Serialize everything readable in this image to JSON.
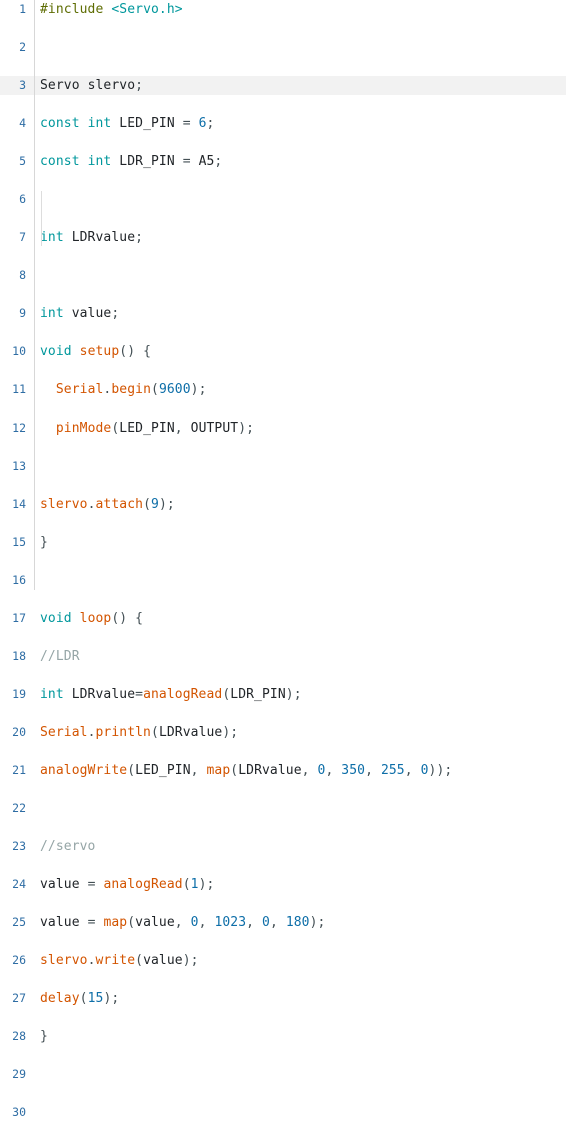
{
  "app": {
    "name": "code-editor",
    "language": "Arduino C++",
    "filename": "sketch"
  },
  "editor": {
    "total_lines": 30,
    "first_visible_line": 1,
    "last_visible_line": 30,
    "highlighted_lines": [
      3
    ],
    "indent_guide_lines": [
      11,
      12,
      13
    ]
  },
  "colors": {
    "background": "#ffffff",
    "highlight_row": "#f2f2f2",
    "gutter_rule": "#d7d7d7",
    "line_number": "#2e6da4",
    "keyword": "#00979c",
    "function": "#d35400",
    "number": "#0d6ea8",
    "comment": "#95a5a6",
    "preprocessor": "#5e6d03",
    "identifier": "#212529",
    "punctuation": "#434f54",
    "indent_guide": "#dddddd"
  },
  "lines": [
    {
      "n": "1",
      "text": "#include <Servo.h>",
      "tokens": [
        {
          "t": "#include",
          "c": "t-pre"
        },
        {
          "t": " ",
          "c": "t-punc"
        },
        {
          "t": "<Servo.h>",
          "c": "t-hdr"
        }
      ]
    },
    {
      "n": "2",
      "text": "",
      "tokens": []
    },
    {
      "n": "3",
      "text": "Servo slervo;",
      "tokens": [
        {
          "t": "Servo",
          "c": "t-id"
        },
        {
          "t": " slervo",
          "c": "t-id"
        },
        {
          "t": ";",
          "c": "t-punc"
        }
      ]
    },
    {
      "n": "4",
      "text": "const int LED_PIN = 6;",
      "tokens": [
        {
          "t": "const",
          "c": "t-kw"
        },
        {
          "t": " ",
          "c": "t-punc"
        },
        {
          "t": "int",
          "c": "t-kw"
        },
        {
          "t": " LED_PIN ",
          "c": "t-id"
        },
        {
          "t": "=",
          "c": "t-op"
        },
        {
          "t": " ",
          "c": "t-punc"
        },
        {
          "t": "6",
          "c": "t-num"
        },
        {
          "t": ";",
          "c": "t-punc"
        }
      ]
    },
    {
      "n": "5",
      "text": "const int LDR_PIN = A5;",
      "tokens": [
        {
          "t": "const",
          "c": "t-kw"
        },
        {
          "t": " ",
          "c": "t-punc"
        },
        {
          "t": "int",
          "c": "t-kw"
        },
        {
          "t": " LDR_PIN ",
          "c": "t-id"
        },
        {
          "t": "=",
          "c": "t-op"
        },
        {
          "t": " A5",
          "c": "t-id"
        },
        {
          "t": ";",
          "c": "t-punc"
        }
      ]
    },
    {
      "n": "6",
      "text": "",
      "tokens": []
    },
    {
      "n": "7",
      "text": "int LDRvalue;",
      "tokens": [
        {
          "t": "int",
          "c": "t-kw"
        },
        {
          "t": " LDRvalue",
          "c": "t-id"
        },
        {
          "t": ";",
          "c": "t-punc"
        }
      ]
    },
    {
      "n": "8",
      "text": "",
      "tokens": []
    },
    {
      "n": "9",
      "text": "int value;",
      "tokens": [
        {
          "t": "int",
          "c": "t-kw"
        },
        {
          "t": " value",
          "c": "t-id"
        },
        {
          "t": ";",
          "c": "t-punc"
        }
      ]
    },
    {
      "n": "10",
      "text": "void setup() {",
      "tokens": [
        {
          "t": "void",
          "c": "t-kw"
        },
        {
          "t": " ",
          "c": "t-punc"
        },
        {
          "t": "setup",
          "c": "t-fn"
        },
        {
          "t": "() {",
          "c": "t-punc"
        }
      ]
    },
    {
      "n": "11",
      "text": "  Serial.begin(9600);",
      "tokens": [
        {
          "t": "  ",
          "c": "t-punc"
        },
        {
          "t": "Serial",
          "c": "t-obj"
        },
        {
          "t": ".",
          "c": "t-punc"
        },
        {
          "t": "begin",
          "c": "t-fn"
        },
        {
          "t": "(",
          "c": "t-punc"
        },
        {
          "t": "9600",
          "c": "t-num"
        },
        {
          "t": ");",
          "c": "t-punc"
        }
      ]
    },
    {
      "n": "12",
      "text": "  pinMode(LED_PIN, OUTPUT);",
      "tokens": [
        {
          "t": "  ",
          "c": "t-punc"
        },
        {
          "t": "pinMode",
          "c": "t-fn"
        },
        {
          "t": "(",
          "c": "t-punc"
        },
        {
          "t": "LED_PIN",
          "c": "t-id"
        },
        {
          "t": ", ",
          "c": "t-punc"
        },
        {
          "t": "OUTPUT",
          "c": "t-id"
        },
        {
          "t": ");",
          "c": "t-punc"
        }
      ]
    },
    {
      "n": "13",
      "text": "",
      "tokens": []
    },
    {
      "n": "14",
      "text": "slervo.attach(9);",
      "tokens": [
        {
          "t": "slervo",
          "c": "t-obj"
        },
        {
          "t": ".",
          "c": "t-punc"
        },
        {
          "t": "attach",
          "c": "t-fn"
        },
        {
          "t": "(",
          "c": "t-punc"
        },
        {
          "t": "9",
          "c": "t-num"
        },
        {
          "t": ");",
          "c": "t-punc"
        }
      ]
    },
    {
      "n": "15",
      "text": "}",
      "tokens": [
        {
          "t": "}",
          "c": "t-punc"
        }
      ]
    },
    {
      "n": "16",
      "text": "",
      "tokens": []
    },
    {
      "n": "17",
      "text": "void loop() {",
      "tokens": [
        {
          "t": "void",
          "c": "t-kw"
        },
        {
          "t": " ",
          "c": "t-punc"
        },
        {
          "t": "loop",
          "c": "t-fn"
        },
        {
          "t": "() {",
          "c": "t-punc"
        }
      ]
    },
    {
      "n": "18",
      "text": "//LDR",
      "tokens": [
        {
          "t": "//LDR",
          "c": "t-cmt"
        }
      ]
    },
    {
      "n": "19",
      "text": "int LDRvalue=analogRead(LDR_PIN);",
      "tokens": [
        {
          "t": "int",
          "c": "t-kw"
        },
        {
          "t": " LDRvalue",
          "c": "t-id"
        },
        {
          "t": "=",
          "c": "t-op"
        },
        {
          "t": "analogRead",
          "c": "t-fn"
        },
        {
          "t": "(",
          "c": "t-punc"
        },
        {
          "t": "LDR_PIN",
          "c": "t-id"
        },
        {
          "t": ");",
          "c": "t-punc"
        }
      ]
    },
    {
      "n": "20",
      "text": "Serial.println(LDRvalue);",
      "tokens": [
        {
          "t": "Serial",
          "c": "t-obj"
        },
        {
          "t": ".",
          "c": "t-punc"
        },
        {
          "t": "println",
          "c": "t-fn"
        },
        {
          "t": "(",
          "c": "t-punc"
        },
        {
          "t": "LDRvalue",
          "c": "t-id"
        },
        {
          "t": ");",
          "c": "t-punc"
        }
      ]
    },
    {
      "n": "21",
      "text": "analogWrite(LED_PIN, map(LDRvalue, 0, 350, 255, 0));",
      "tokens": [
        {
          "t": "analogWrite",
          "c": "t-fn"
        },
        {
          "t": "(",
          "c": "t-punc"
        },
        {
          "t": "LED_PIN",
          "c": "t-id"
        },
        {
          "t": ", ",
          "c": "t-punc"
        },
        {
          "t": "map",
          "c": "t-fn"
        },
        {
          "t": "(",
          "c": "t-punc"
        },
        {
          "t": "LDRvalue",
          "c": "t-id"
        },
        {
          "t": ", ",
          "c": "t-punc"
        },
        {
          "t": "0",
          "c": "t-num"
        },
        {
          "t": ", ",
          "c": "t-punc"
        },
        {
          "t": "350",
          "c": "t-num"
        },
        {
          "t": ", ",
          "c": "t-punc"
        },
        {
          "t": "255",
          "c": "t-num"
        },
        {
          "t": ", ",
          "c": "t-punc"
        },
        {
          "t": "0",
          "c": "t-num"
        },
        {
          "t": "));",
          "c": "t-punc"
        }
      ]
    },
    {
      "n": "22",
      "text": "",
      "tokens": []
    },
    {
      "n": "23",
      "text": "//servo",
      "tokens": [
        {
          "t": "//servo",
          "c": "t-cmt"
        }
      ]
    },
    {
      "n": "24",
      "text": "value = analogRead(1);",
      "tokens": [
        {
          "t": "value ",
          "c": "t-id"
        },
        {
          "t": "=",
          "c": "t-op"
        },
        {
          "t": " ",
          "c": "t-punc"
        },
        {
          "t": "analogRead",
          "c": "t-fn"
        },
        {
          "t": "(",
          "c": "t-punc"
        },
        {
          "t": "1",
          "c": "t-num"
        },
        {
          "t": ");",
          "c": "t-punc"
        }
      ]
    },
    {
      "n": "25",
      "text": "value = map(value, 0, 1023, 0, 180);",
      "tokens": [
        {
          "t": "value ",
          "c": "t-id"
        },
        {
          "t": "=",
          "c": "t-op"
        },
        {
          "t": " ",
          "c": "t-punc"
        },
        {
          "t": "map",
          "c": "t-fn"
        },
        {
          "t": "(",
          "c": "t-punc"
        },
        {
          "t": "value",
          "c": "t-id"
        },
        {
          "t": ", ",
          "c": "t-punc"
        },
        {
          "t": "0",
          "c": "t-num"
        },
        {
          "t": ", ",
          "c": "t-punc"
        },
        {
          "t": "1023",
          "c": "t-num"
        },
        {
          "t": ", ",
          "c": "t-punc"
        },
        {
          "t": "0",
          "c": "t-num"
        },
        {
          "t": ", ",
          "c": "t-punc"
        },
        {
          "t": "180",
          "c": "t-num"
        },
        {
          "t": ");",
          "c": "t-punc"
        }
      ]
    },
    {
      "n": "26",
      "text": "slervo.write(value);",
      "tokens": [
        {
          "t": "slervo",
          "c": "t-obj"
        },
        {
          "t": ".",
          "c": "t-punc"
        },
        {
          "t": "write",
          "c": "t-fn"
        },
        {
          "t": "(",
          "c": "t-punc"
        },
        {
          "t": "value",
          "c": "t-id"
        },
        {
          "t": ");",
          "c": "t-punc"
        }
      ]
    },
    {
      "n": "27",
      "text": "delay(15);",
      "tokens": [
        {
          "t": "delay",
          "c": "t-fn"
        },
        {
          "t": "(",
          "c": "t-punc"
        },
        {
          "t": "15",
          "c": "t-num"
        },
        {
          "t": ");",
          "c": "t-punc"
        }
      ]
    },
    {
      "n": "28",
      "text": "}",
      "tokens": [
        {
          "t": "}",
          "c": "t-punc"
        }
      ]
    },
    {
      "n": "29",
      "text": "",
      "tokens": []
    },
    {
      "n": "30",
      "text": "",
      "tokens": []
    }
  ]
}
